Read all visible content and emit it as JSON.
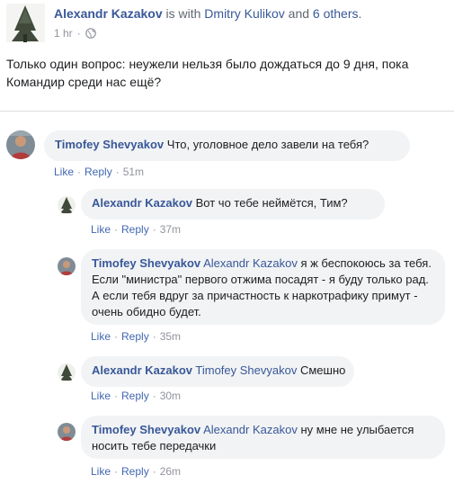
{
  "post": {
    "author": "Alexandr Kazakov",
    "with_text": " is with ",
    "tagged": "Dmitry Kulikov",
    "and_text": " and ",
    "others": "6 others",
    "period": ".",
    "time": "1 hr",
    "dot": "·",
    "body": "Только один вопрос: неужели нельзя было дождаться до 9 дня, пока Командир среди нас ещё?"
  },
  "comments": [
    {
      "author": "Timofey Shevyakov",
      "mention": "",
      "text": "Что, уголовное дело завели на тебя?",
      "like": "Like",
      "reply": "Reply",
      "sep": "·",
      "time": "51m"
    },
    {
      "author": "Alexandr Kazakov",
      "mention": "",
      "text": "Вот чо тебе неймётся, Тим?",
      "like": "Like",
      "reply": "Reply",
      "sep": "·",
      "time": "37m"
    },
    {
      "author": "Timofey Shevyakov",
      "mention": "Alexandr Kazakov",
      "text": "я ж беспокоюсь за тебя. Если \"министра\" первого отжима посадят - я буду только рад. А если тебя вдруг за причастность к наркотрафику примут - очень обидно будет.",
      "like": "Like",
      "reply": "Reply",
      "sep": "·",
      "time": "35m"
    },
    {
      "author": "Alexandr Kazakov",
      "mention": "Timofey Shevyakov",
      "text": "Смешно",
      "like": "Like",
      "reply": "Reply",
      "sep": "·",
      "time": "30m"
    },
    {
      "author": "Timofey Shevyakov",
      "mention": "Alexandr Kazakov",
      "text": "ну мне не улыбается носить тебе передачки",
      "like": "Like",
      "reply": "Reply",
      "sep": "·",
      "time": "26m"
    }
  ],
  "colors": {
    "link": "#385898",
    "action": "#4267b2",
    "bubble": "#f2f3f5",
    "meta": "#90949c"
  },
  "icons": {
    "privacy": "globe-icon",
    "post_avatar": "pine-tree-icon"
  }
}
